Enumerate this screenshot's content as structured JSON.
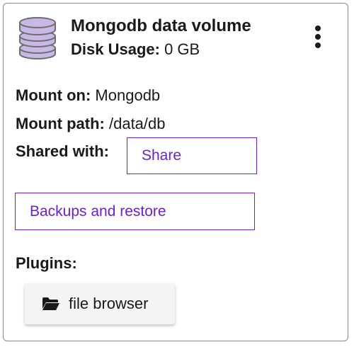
{
  "volume": {
    "title": "Mongodb data volume",
    "usage_label": "Disk Usage:",
    "usage_value": "0 GB",
    "icon": "database-icon"
  },
  "details": {
    "mount_on_label": "Mount on:",
    "mount_on_value": "Mongodb",
    "mount_path_label": "Mount path:",
    "mount_path_value": "/data/db",
    "shared_with_label": "Shared with:"
  },
  "buttons": {
    "share": "Share",
    "backups": "Backups and restore"
  },
  "plugins": {
    "label": "Plugins:",
    "items": [
      {
        "label": "file browser",
        "icon": "folder-open-icon"
      }
    ]
  },
  "colors": {
    "accent": "#6b1fd6",
    "db_icon_fill": "#c8b8e6",
    "db_icon_stroke": "#6e6e6e"
  }
}
